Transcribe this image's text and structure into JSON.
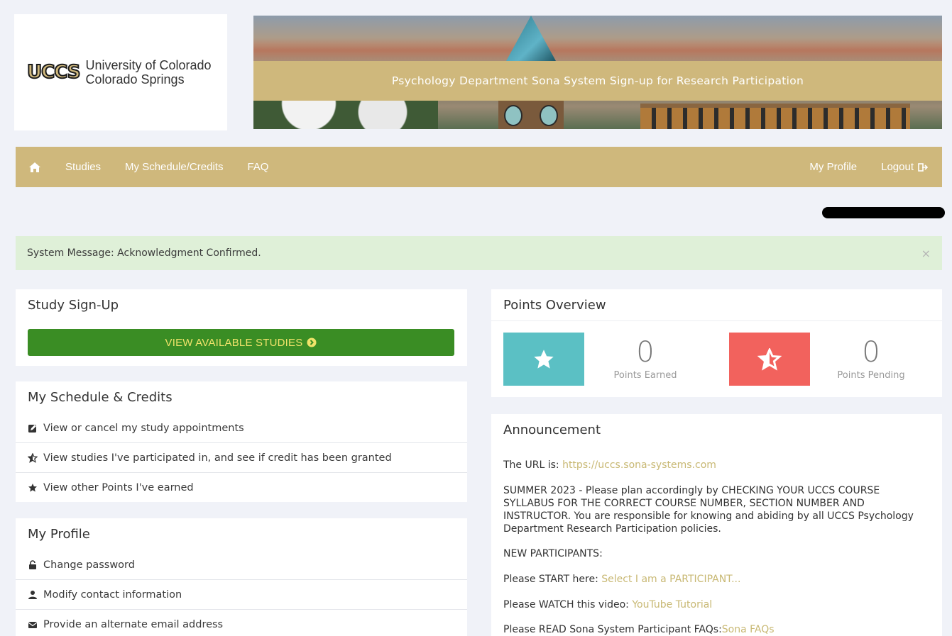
{
  "header": {
    "logo_mark": "UCCS",
    "logo_line1": "University of Colorado",
    "logo_line2": "Colorado Springs",
    "banner_title": "Psychology Department Sona System Sign-up for Research Participation"
  },
  "nav": {
    "home_icon": "home-icon",
    "items": [
      "Studies",
      "My Schedule/Credits",
      "FAQ"
    ],
    "right_items": [
      "My Profile",
      "Logout"
    ],
    "logout_icon": "sign-out-icon"
  },
  "alert": {
    "text": "System Message: Acknowledgment Confirmed.",
    "close": "×"
  },
  "study_signup": {
    "title": "Study Sign-Up",
    "button_label": "VIEW AVAILABLE STUDIES",
    "button_icon": "chevron-circle-right-icon"
  },
  "schedule": {
    "title": "My Schedule & Credits",
    "items": [
      {
        "label": "View or cancel my study appointments",
        "icon": "edit-icon"
      },
      {
        "label": "View studies I've participated in, and see if credit has been granted",
        "icon": "star-half-icon"
      },
      {
        "label": "View other Points I've earned",
        "icon": "star-icon"
      }
    ]
  },
  "profile": {
    "title": "My Profile",
    "items": [
      {
        "label": "Change password",
        "icon": "unlock-icon"
      },
      {
        "label": "Modify contact information",
        "icon": "user-icon"
      },
      {
        "label": "Provide an alternate email address",
        "icon": "envelope-icon"
      }
    ]
  },
  "points": {
    "title": "Points Overview",
    "earned_value": "0",
    "earned_label": "Points Earned",
    "pending_value": "0",
    "pending_label": "Points Pending",
    "colors": {
      "earned": "#5bc0c4",
      "pending": "#f2625d"
    }
  },
  "announcement": {
    "title": "Announcement",
    "url_prefix": "The URL is: ",
    "url_link": "https://uccs.sona-systems.com",
    "summer": "SUMMER 2023 - Please plan accordingly by CHECKING YOUR UCCS COURSE SYLLABUS FOR THE CORRECT COURSE NUMBER, SECTION NUMBER AND INSTRUCTOR. You are responsible for knowing and abiding by all UCCS Psychology Department Research Participation policies.",
    "new_participants": "NEW PARTICIPANTS:",
    "start_prefix": "Please START here: ",
    "start_link": "Select I am a PARTICIPANT...",
    "watch_prefix": "Please WATCH this video: ",
    "watch_link": "YouTube Tutorial",
    "read_prefix": "Please READ Sona System Participant FAQs:",
    "read_link": "Sona FAQs"
  }
}
